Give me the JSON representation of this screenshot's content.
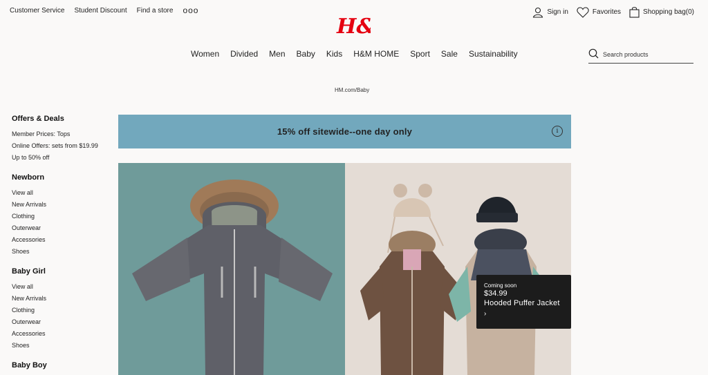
{
  "topbar": {
    "customer_service": "Customer Service",
    "student_discount": "Student Discount",
    "find_store": "Find a store",
    "more": "ooo"
  },
  "brand": {
    "logo_text": "H&M",
    "logo_color": "#e50010"
  },
  "account": {
    "sign_in": "Sign in",
    "favorites": "Favorites",
    "bag": "Shopping bag(0)"
  },
  "nav": {
    "items": [
      "Women",
      "Divided",
      "Men",
      "Baby",
      "Kids",
      "H&M HOME",
      "Sport",
      "Sale",
      "Sustainability"
    ]
  },
  "search": {
    "placeholder": "Search products"
  },
  "breadcrumb": "HM.com/Baby",
  "sidebar": {
    "offers": {
      "title": "Offers & Deals",
      "items": [
        "Member Prices: Tops",
        "Online Offers: sets from $19.99",
        "Up to 50% off"
      ]
    },
    "newborn": {
      "title": "Newborn",
      "items": [
        "View all",
        "New Arrivals",
        "Clothing",
        "Outerwear",
        "Accessories",
        "Shoes"
      ]
    },
    "baby_girl": {
      "title": "Baby Girl",
      "items": [
        "View all",
        "New Arrivals",
        "Clothing",
        "Outerwear",
        "Accessories",
        "Shoes"
      ]
    },
    "baby_boy": {
      "title": "Baby Boy"
    }
  },
  "banner": {
    "text": "15% off sitewide--one day only",
    "color": "#72a8bd",
    "info": "i"
  },
  "product_card": {
    "status": "Coming soon",
    "price": "$34.99",
    "name": "Hooded Puffer Jacket",
    "arrow": "›"
  }
}
